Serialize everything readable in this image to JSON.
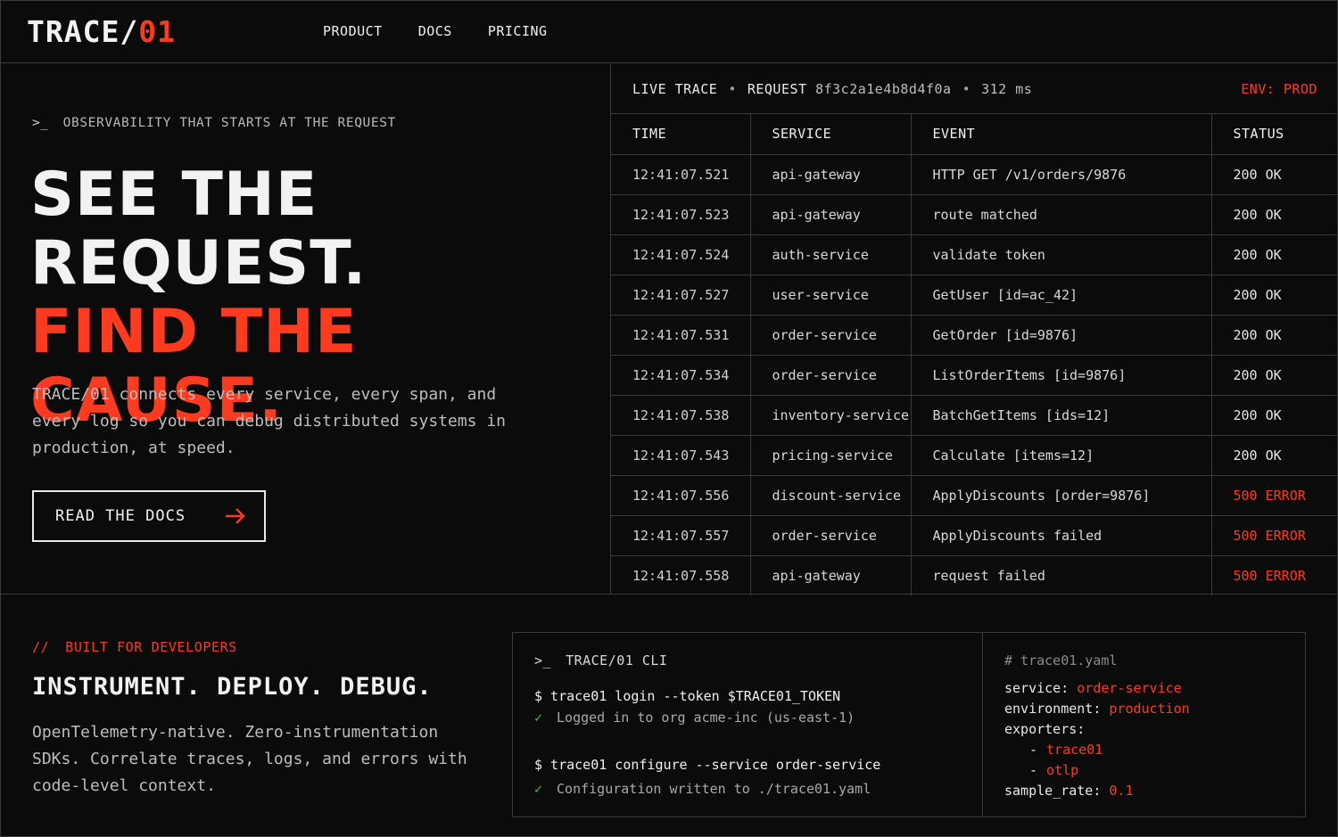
{
  "nav": {
    "logo_main": "TRACE/",
    "logo_accent": "01",
    "links": [
      "PRODUCT",
      "DOCS",
      "PRICING"
    ]
  },
  "hero": {
    "eyebrow_prompt": ">_",
    "eyebrow": "OBSERVABILITY THAT STARTS AT THE REQUEST",
    "headline_1": "SEE THE",
    "headline_2": "REQUEST.",
    "headline_3": "FIND THE CAUSE.",
    "description": "TRACE/01 connects every service, every span, and every log so you can debug distributed systems in production, at speed.",
    "cta_label": "READ THE DOCS"
  },
  "trace": {
    "label": "LIVE TRACE",
    "request_label": "REQUEST",
    "request_id": "8f3c2a1e4b8d4f0a",
    "duration": "312 ms",
    "env": "ENV: PROD",
    "columns": [
      "TIME",
      "SERVICE",
      "EVENT",
      "STATUS"
    ],
    "rows": [
      {
        "time": "12:41:07.521",
        "service": "api-gateway",
        "event": "HTTP GET /v1/orders/9876",
        "status": "200 OK"
      },
      {
        "time": "12:41:07.523",
        "service": "api-gateway",
        "event": "route matched",
        "status": "200 OK"
      },
      {
        "time": "12:41:07.524",
        "service": "auth-service",
        "event": "validate token",
        "status": "200 OK"
      },
      {
        "time": "12:41:07.527",
        "service": "user-service",
        "event": "GetUser  [id=ac_42]",
        "status": "200 OK"
      },
      {
        "time": "12:41:07.531",
        "service": "order-service",
        "event": "GetOrder  [id=9876]",
        "status": "200 OK"
      },
      {
        "time": "12:41:07.534",
        "service": "order-service",
        "event": "ListOrderItems  [id=9876]",
        "status": "200 OK"
      },
      {
        "time": "12:41:07.538",
        "service": "inventory-service",
        "event": "BatchGetItems  [ids=12]",
        "status": "200 OK"
      },
      {
        "time": "12:41:07.543",
        "service": "pricing-service",
        "event": "Calculate  [items=12]",
        "status": "200 OK"
      },
      {
        "time": "12:41:07.556",
        "service": "discount-service",
        "event": "ApplyDiscounts  [order=9876]",
        "status": "500 ERROR"
      },
      {
        "time": "12:41:07.557",
        "service": "order-service",
        "event": "ApplyDiscounts failed",
        "status": "500 ERROR"
      },
      {
        "time": "12:41:07.558",
        "service": "api-gateway",
        "event": "request failed",
        "status": "500 ERROR"
      }
    ]
  },
  "bottom": {
    "eyebrow_slashes": "//",
    "eyebrow": "BUILT FOR DEVELOPERS",
    "title": "INSTRUMENT. DEPLOY. DEBUG.",
    "description": "OpenTelemetry-native. Zero-instrumentation SDKs. Correlate traces, logs, and errors with code-level context."
  },
  "cli": {
    "prompt": ">_",
    "title": "TRACE/01 CLI",
    "cmd1": "$ trace01 login --token $TRACE01_TOKEN",
    "check": "✓",
    "out1": "Logged in to org acme-inc (us-east-1)",
    "cmd2": "$ trace01 configure --service order-service",
    "out2": "Configuration written to ./trace01.yaml"
  },
  "yaml": {
    "comment": "# trace01.yaml",
    "service_key": "service:",
    "service_val": "order-service",
    "env_key": "environment:",
    "env_val": "production",
    "exporters_key": "exporters:",
    "dash": "-",
    "exporter_1": "trace01",
    "exporter_2": "otlp",
    "sample_key": "sample_rate:",
    "sample_val": "0.1"
  },
  "colors": {
    "accent": "#ff3b1f",
    "background": "#0b0b0c",
    "success": "#3fbf6a"
  }
}
